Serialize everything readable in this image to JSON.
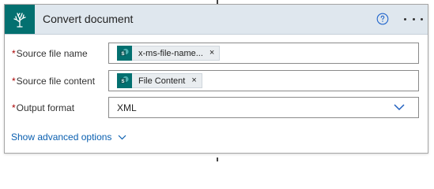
{
  "header": {
    "title": "Convert document",
    "colors": {
      "header_bg": "#dfe7ee",
      "icon_bg": "#037070",
      "link": "#0a5fb0",
      "required": "#a80000"
    }
  },
  "fields": [
    {
      "required_mark": "*",
      "label": "Source file name",
      "token_text": "x-ms-file-name...",
      "token_close": "×",
      "token_icon": "sharepoint-icon"
    },
    {
      "required_mark": "*",
      "label": "Source file content",
      "token_text": "File Content",
      "token_close": "×",
      "token_icon": "sharepoint-icon"
    },
    {
      "required_mark": "*",
      "label": "Output format",
      "value": "XML"
    }
  ],
  "advanced": {
    "label": "Show advanced options"
  }
}
